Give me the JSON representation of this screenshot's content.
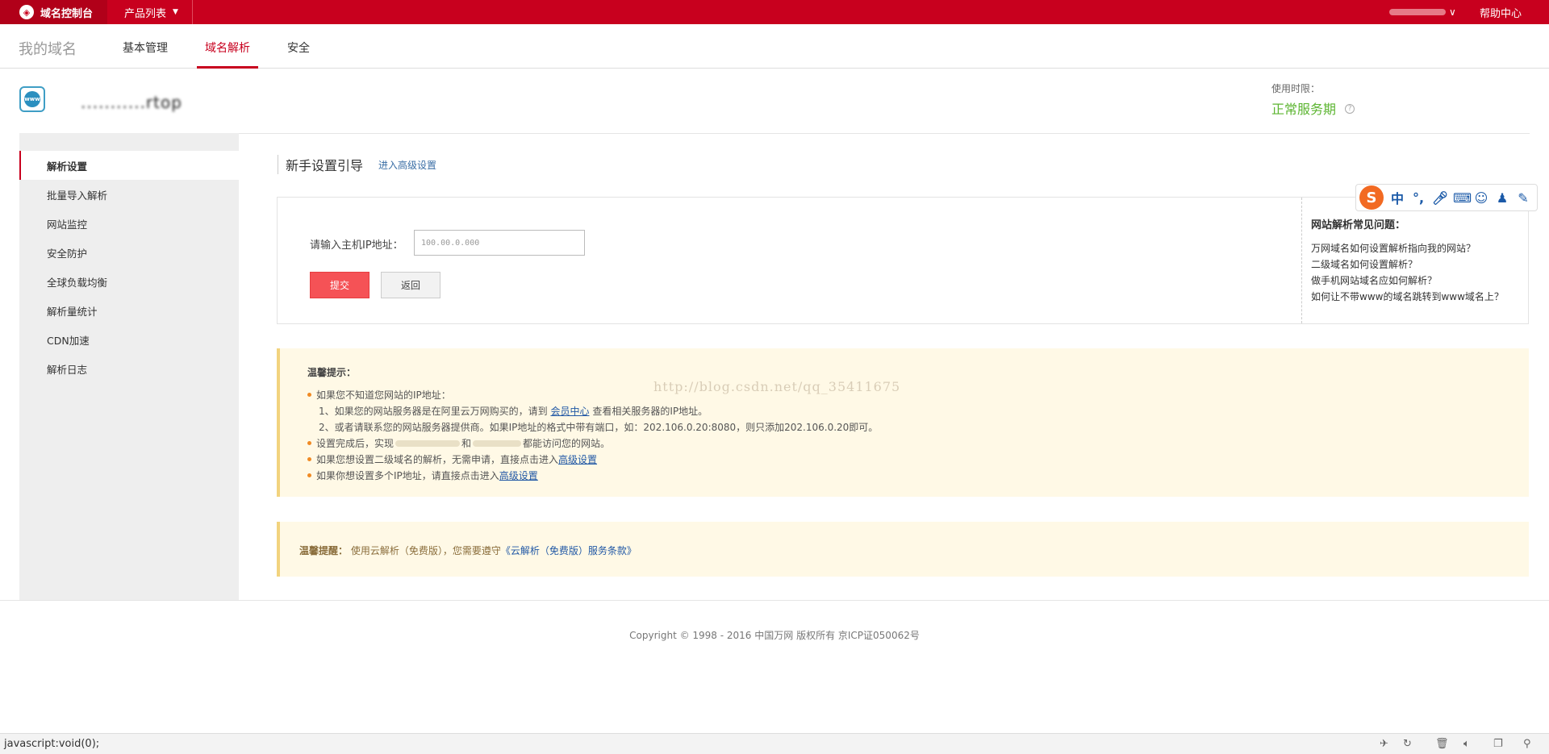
{
  "topbar": {
    "brand": "域名控制台",
    "products": "产品列表",
    "user_suffix": "∨",
    "help": "帮助中心"
  },
  "subnav": {
    "title": "我的域名",
    "tabs": [
      "基本管理",
      "域名解析",
      "安全"
    ]
  },
  "domain": {
    "name": "...........rtop",
    "service_label": "使用时限：",
    "service_status": "正常服务期"
  },
  "sidebar": {
    "items": [
      "解析设置",
      "批量导入解析",
      "网站监控",
      "安全防护",
      "全球负载均衡",
      "解析量统计",
      "CDN加速",
      "解析日志"
    ]
  },
  "guide": {
    "title": "新手设置引导",
    "link": "进入高级设置"
  },
  "form": {
    "ip_label": "请输入主机IP地址：",
    "ip_value": "100.00.0.000",
    "submit": "提交",
    "back": "返回"
  },
  "faq": {
    "title": "网站解析常见问题：",
    "items": [
      "万网域名如何设置解析指向我的网站？",
      "二级域名如何设置解析？",
      "做手机网站域名应如何解析？",
      "如何让不带www的域名跳转到www域名上？"
    ]
  },
  "ime": {
    "logo": "S",
    "mode": "中"
  },
  "tips": {
    "title": "温馨提示：",
    "l1": "如果您不知道您网站的IP地址：",
    "l2a": "1、如果您的网站服务器是在阿里云万网购买的，请到",
    "l2link": "会员中心",
    "l2b": "查看相关服务器的IP地址。",
    "l3": "2、或者请联系您的网站服务器提供商。如果IP地址的格式中带有端口，如：202.106.0.20:8080，则只添加202.106.0.20即可。",
    "l4a": "设置完成后，实现",
    "l4b": "和",
    "l4c": "都能访问您的网站。",
    "l5a": "如果您想设置二级域名的解析，无需申请，直接点击进入",
    "l5link": "高级设置",
    "l6a": "如果你想设置多个IP地址，请直接点击进入",
    "l6link": "高级设置",
    "watermark": "http://blog.csdn.net/qq_35411675"
  },
  "notice": {
    "label": "温馨提醒：",
    "text": "使用云解析（免费版），您需要遵守",
    "link": "《云解析（免费版）服务条款》"
  },
  "footer": {
    "copyright": "Copyright © 1998 - 2016 中国万网 版权所有 京ICP证050062号"
  },
  "statusbar": {
    "text": "javascript:void(0);"
  }
}
